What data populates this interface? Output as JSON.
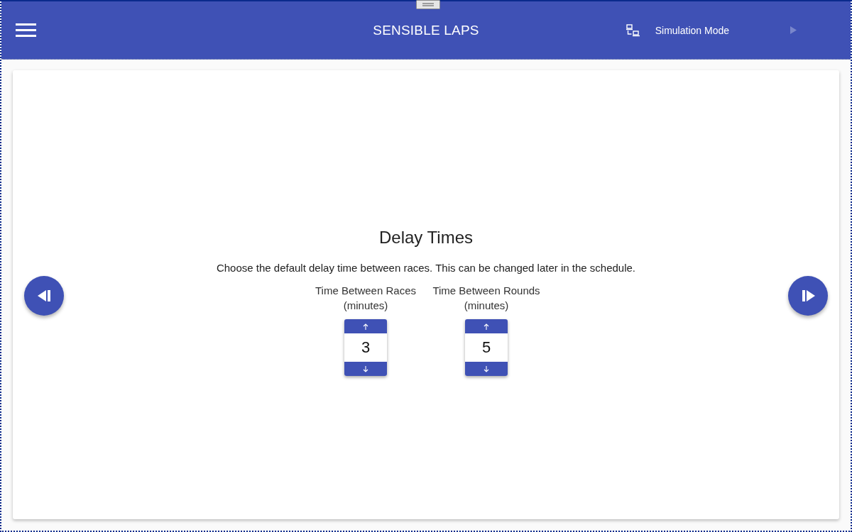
{
  "window": {
    "title": "SENSIBLE LAPS"
  },
  "header": {
    "mode_label": "Simulation Mode",
    "play_button": {
      "disabled": true
    }
  },
  "step": {
    "title": "Delay Times",
    "description": "Choose the default delay time between races. This can be changed later in the schedule.",
    "fields": [
      {
        "label": "Time Between Races",
        "unit": "(minutes)",
        "value": "3"
      },
      {
        "label": "Time Between Rounds",
        "unit": "(minutes)",
        "value": "5"
      }
    ]
  }
}
